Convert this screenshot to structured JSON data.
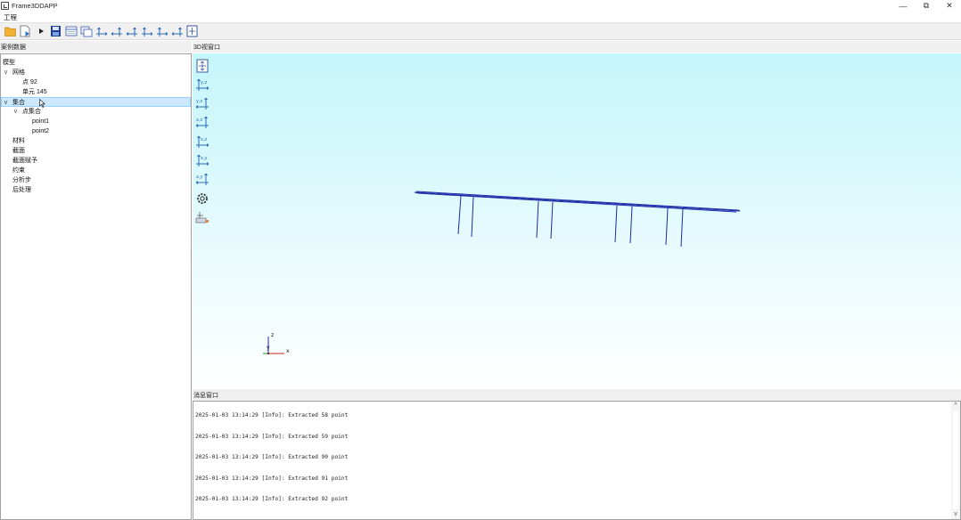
{
  "window": {
    "title": "Frame3DDAPP",
    "minimize": "—",
    "restore": "⧉",
    "close": "✕"
  },
  "menu": {
    "items": [
      "工程"
    ]
  },
  "toolbar": {
    "buttons": [
      "folder-icon",
      "new-file-icon",
      "play-icon",
      "save-disk-icon",
      "window-icon",
      "copy-window-icon",
      "view-yz-icon",
      "view-zy-icon",
      "view-xz-icon",
      "view-zx-icon",
      "view-xy-icon",
      "view-yx-icon",
      "fit-view-icon"
    ]
  },
  "tree_panel": {
    "header": "案例数据",
    "items": [
      {
        "label": "模型",
        "level": 0,
        "chevron": ""
      },
      {
        "label": "网格",
        "level": 0,
        "chevron": "v"
      },
      {
        "label": "点 92",
        "level": 2,
        "chevron": ""
      },
      {
        "label": "单元 145",
        "level": 2,
        "chevron": ""
      },
      {
        "label": "集合",
        "level": 0,
        "chevron": "v",
        "selected": true
      },
      {
        "label": "点集合",
        "level": 1,
        "chevron": "v"
      },
      {
        "label": "point1",
        "level": 3,
        "chevron": ""
      },
      {
        "label": "point2",
        "level": 3,
        "chevron": ""
      },
      {
        "label": "材料",
        "level": 0,
        "chevron": ""
      },
      {
        "label": "截面",
        "level": 0,
        "chevron": ""
      },
      {
        "label": "截面赋予",
        "level": 0,
        "chevron": ""
      },
      {
        "label": "约束",
        "level": 0,
        "chevron": ""
      },
      {
        "label": "分析步",
        "level": 0,
        "chevron": ""
      },
      {
        "label": "后处理",
        "level": 0,
        "chevron": ""
      }
    ]
  },
  "viewport": {
    "header": "3D视窗口",
    "bg_top": "#c4f6fb",
    "bg_bottom": "#ffffff",
    "model_color": "#1d2ca8",
    "tools": [
      {
        "icon": "fit-all-icon",
        "label": ""
      },
      {
        "icon": "view-yz-icon",
        "label": "y,z"
      },
      {
        "icon": "view-zy-icon",
        "label": "y,z"
      },
      {
        "icon": "view-xz-icon",
        "label": "x,z"
      },
      {
        "icon": "view-zx-icon",
        "label": "x,z"
      },
      {
        "icon": "view-xy-icon",
        "label": "x,y"
      },
      {
        "icon": "view-yx-icon",
        "label": "x,y"
      },
      {
        "icon": "settings-gear-icon",
        "label": ""
      },
      {
        "icon": "ruler-icon",
        "label": ""
      }
    ],
    "axes": {
      "x": "x",
      "y": "y",
      "z": "z"
    }
  },
  "log_panel": {
    "header": "消息窗口",
    "lines": [
      "2025-01-03 13:14:29 [Info]: Extracted  58  point",
      "2025-01-03 13:14:29 [Info]: Extracted  59  point",
      "2025-01-03 13:14:29 [Info]: Extracted  90  point",
      "2025-01-03 13:14:29 [Info]: Extracted  91  point",
      "2025-01-03 13:14:29 [Info]: Extracted  92  point"
    ],
    "scroll_up": "^",
    "scroll_down": "v"
  }
}
